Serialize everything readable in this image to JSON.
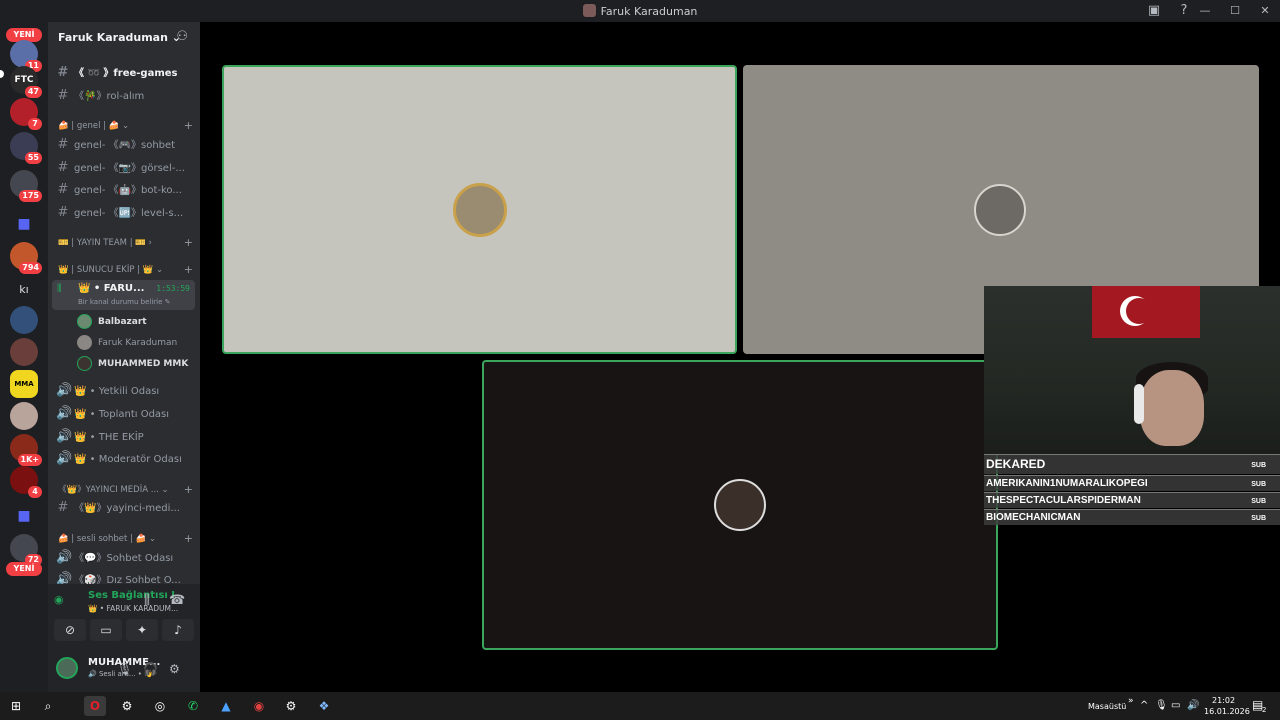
{
  "window": {
    "title": "Faruk Karaduman"
  },
  "server": {
    "name": "Faruk Karaduman ⌄"
  },
  "guilds": {
    "badges": [
      "11",
      "47",
      "7",
      "55",
      "175",
      "794",
      "1K+",
      "4",
      "72"
    ],
    "new_label": "YENİ",
    "ki_label": "kı"
  },
  "channels": {
    "items": [
      {
        "prefix": "#",
        "label": "《 ➿ 》free-games"
      },
      {
        "prefix": "#",
        "label": "《🎋》rol-alım"
      },
      {
        "prefix": "#",
        "label": "genel- 《🎮》sohbet"
      },
      {
        "prefix": "#",
        "label": "genel- 《📷》görsel-..."
      },
      {
        "prefix": "#",
        "label": "genel- 《🤖》bot-ko..."
      },
      {
        "prefix": "#",
        "label": "genel- 《🆙》level-s..."
      }
    ],
    "categories": [
      "🍰 | genel | 🍰 ⌄",
      "🎫 | YAYIN TEAM | 🎫 ›",
      "👑 | SUNUCU EKİP | 👑 ⌄",
      "《👑》YAYINCI MEDİA ... ⌄",
      "🍰 | sesli sohbet | 🍰 ⌄"
    ],
    "active_voice": {
      "name": "👑 • FARU...",
      "time": "1:53:59",
      "status": "Bir kanal durumu belirle ✎"
    },
    "voice_users": [
      "Balbazart",
      "Faruk Karaduman",
      "MUHAMMED MMK"
    ],
    "voice_channels": [
      "👑 • Yetkili Odası",
      "👑 • Toplantı Odası",
      "👑 • THE EKİP",
      "👑 • Moderatör Odası"
    ],
    "media_channel": "《👑》yayinci-medi...",
    "sesli": [
      "《💬》Sohbet Odası",
      "《🎲》Dız Sohbet O..."
    ]
  },
  "voice_panel": {
    "status": "Ses Bağlantısı Kuruldu",
    "channel": "👑 • FARUK KARADUM..."
  },
  "user": {
    "name": "MUHAMME...",
    "status": "🔊 Sesli ara... • 👋"
  },
  "stream_overlay": {
    "top_name": "DEKARED",
    "names": [
      "AMERIKANIN1NUMARALIKOPEGI",
      "THESPECTACULARSPIDERMAN",
      "BIOMECHANICMAN"
    ],
    "sub_label": "SUB"
  },
  "taskbar": {
    "desktop_label": "Masaüstü",
    "time": "21:02",
    "date": "16.01.2026",
    "notif_count": "2"
  },
  "colors": {
    "speaking_border": "#3ba55c",
    "badge": "#f23f43",
    "tile1_bg": "#c5c5bd",
    "tile2_bg": "#8f8c86",
    "tile3_bg": "#171413"
  }
}
